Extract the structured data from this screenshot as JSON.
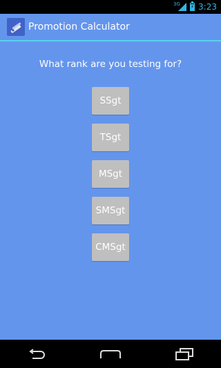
{
  "status_bar": {
    "network": "3G",
    "time": "3:23",
    "accent_color": "#33b5e5"
  },
  "action_bar": {
    "title": "Promotion Calculator",
    "icon": "app-launcher-icon"
  },
  "main": {
    "question": "What rank are you testing for?",
    "ranks": [
      "SSgt",
      "TSgt",
      "MSgt",
      "SMSgt",
      "CMSgt"
    ],
    "background_color": "#6495ed",
    "button_color": "#bfbfbf"
  },
  "nav_bar": {
    "icons": [
      "back-icon",
      "home-icon",
      "recent-apps-icon"
    ]
  }
}
